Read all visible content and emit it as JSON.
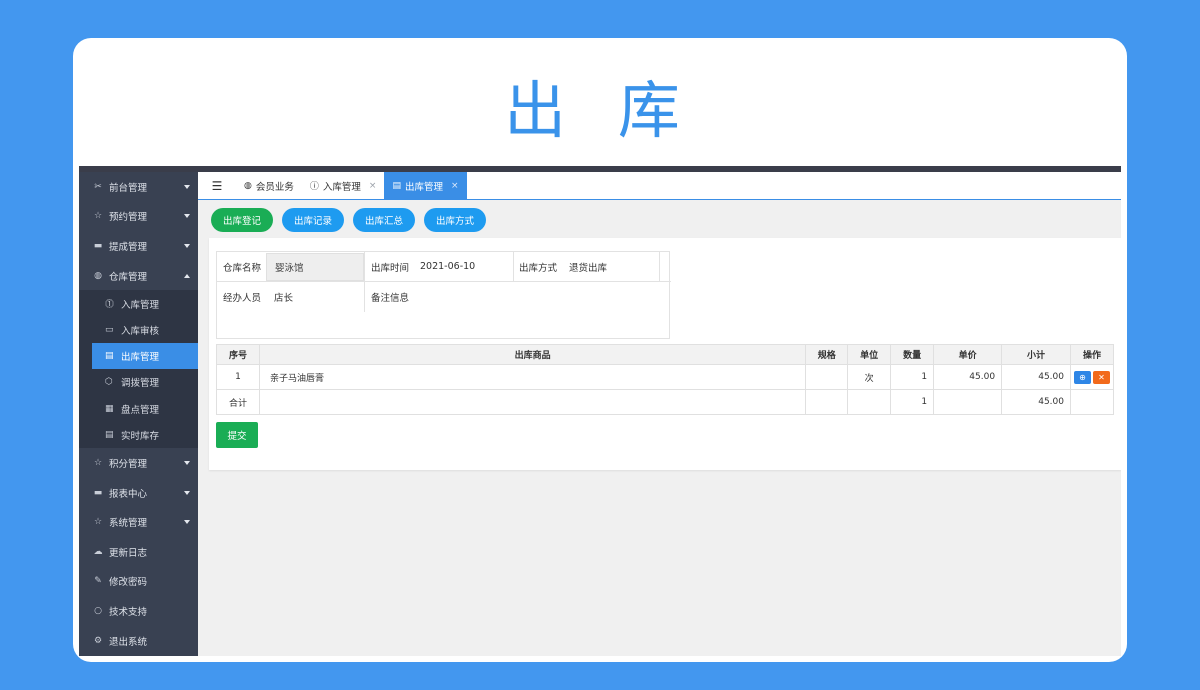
{
  "hero_title": "出 库",
  "sidebar": {
    "items": [
      {
        "label": "前台管理",
        "icon": "scissors-icon",
        "glyph": "✂",
        "caret": "down"
      },
      {
        "label": "预约管理",
        "icon": "star-icon",
        "glyph": "☆",
        "caret": "down"
      },
      {
        "label": "提成管理",
        "icon": "monitor-icon",
        "glyph": "▬",
        "caret": "down"
      },
      {
        "label": "仓库管理",
        "icon": "dashboard-icon",
        "glyph": "◍",
        "caret": "up"
      }
    ],
    "sub_items": [
      {
        "label": "入库管理",
        "icon": "upload-circle-icon",
        "glyph": "⓵"
      },
      {
        "label": "入库审核",
        "icon": "card-icon",
        "glyph": "▭"
      },
      {
        "label": "出库管理",
        "icon": "clipboard-icon",
        "glyph": "▤"
      },
      {
        "label": "调拨管理",
        "icon": "cube-icon",
        "glyph": "⬡"
      },
      {
        "label": "盘点管理",
        "icon": "calendar-icon",
        "glyph": "▦"
      },
      {
        "label": "实时库存",
        "icon": "clipboard-list-icon",
        "glyph": "▤"
      }
    ],
    "bottom_items": [
      {
        "label": "积分管理",
        "icon": "star-icon",
        "glyph": "☆",
        "caret": "down"
      },
      {
        "label": "报表中心",
        "icon": "monitor-icon",
        "glyph": "▬",
        "caret": "down"
      },
      {
        "label": "系统管理",
        "icon": "star-icon",
        "glyph": "☆",
        "caret": "down"
      },
      {
        "label": "更新日志",
        "icon": "cloud-icon",
        "glyph": "☁"
      },
      {
        "label": "修改密码",
        "icon": "edit-icon",
        "glyph": "✎"
      },
      {
        "label": "技术支持",
        "icon": "chat-icon",
        "glyph": "○"
      },
      {
        "label": "退出系统",
        "icon": "gears-icon",
        "glyph": "⚙"
      }
    ]
  },
  "tabs": {
    "toggle_glyph": "☰",
    "items": [
      {
        "label": "会员业务",
        "glyph": "◍",
        "icon": "dashboard-icon",
        "closable": false
      },
      {
        "label": "入库管理",
        "glyph": "ⓘ",
        "icon": "upload-circle-icon",
        "closable": true
      },
      {
        "label": "出库管理",
        "glyph": "▤",
        "icon": "clipboard-icon",
        "closable": true,
        "active": true
      }
    ],
    "close_glyph": "×"
  },
  "actions": {
    "register": "出库登记",
    "records": "出库记录",
    "summary": "出库汇总",
    "method": "出库方式"
  },
  "form": {
    "warehouse_label": "仓库名称",
    "warehouse_value": "婴泳馆",
    "time_label": "出库时间",
    "time_value": "2021-06-10",
    "method_label": "出库方式",
    "method_value": "退货出库",
    "handler_label": "经办人员",
    "handler_value": "店长",
    "remark_label": "备注信息"
  },
  "table": {
    "headers": [
      "序号",
      "出库商品",
      "规格",
      "单位",
      "数量",
      "单价",
      "小计",
      "操作"
    ],
    "rows": [
      {
        "no": "1",
        "product": "亲子马油唇膏",
        "spec": "",
        "unit": "次",
        "qty": "1",
        "price": "45.00",
        "subtotal": "45.00"
      }
    ],
    "total": {
      "label": "合计",
      "qty": "1",
      "subtotal": "45.00"
    },
    "add_glyph": "⊕",
    "delete_glyph": "🗑"
  },
  "submit_label": "提交",
  "colors": {
    "accent": "#3a8ee6",
    "green": "#1aad55",
    "sidebar": "#394152",
    "page_bg": "#4397ef"
  }
}
